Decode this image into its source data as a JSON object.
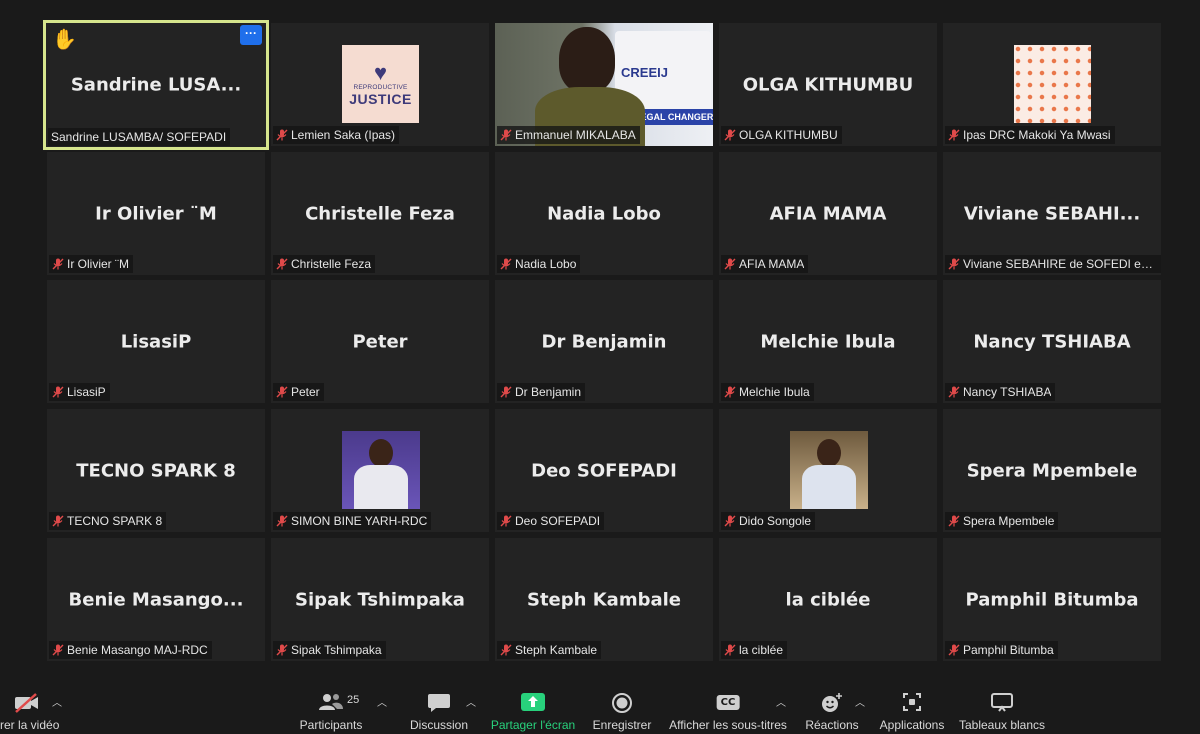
{
  "active_tile": {
    "center_name": "Sandrine LUSA...",
    "tag_name": "Sandrine LUSAMBA/ SOFEPADI",
    "more_label": "···"
  },
  "tiles": [
    {
      "tag": "Lemien Saka (Ipas)",
      "center": "",
      "video": "reproductive-justice-logo"
    },
    {
      "tag": "Emmanuel MIKALABA",
      "center": "",
      "video": "camera-feed"
    },
    {
      "tag": "OLGA KITHUMBU",
      "center": "OLGA KITHUMBU"
    },
    {
      "tag": "Ipas DRC Makoki Ya Mwasi",
      "center": "",
      "video": "pattern-logo"
    },
    {
      "tag": "Ir Olivier ¨M",
      "center": "Ir Olivier ¨M"
    },
    {
      "tag": "Christelle Feza",
      "center": "Christelle Feza"
    },
    {
      "tag": "Nadia Lobo",
      "center": "Nadia Lobo"
    },
    {
      "tag": "AFIA MAMA",
      "center": "AFIA MAMA"
    },
    {
      "tag": "Viviane SEBAHIRE de SOFEDI en R...",
      "center": "Viviane  SEBAHI..."
    },
    {
      "tag": "LisasiP",
      "center": "LisasiP"
    },
    {
      "tag": "Peter",
      "center": "Peter"
    },
    {
      "tag": "Dr Benjamin",
      "center": "Dr Benjamin"
    },
    {
      "tag": "Melchie Ibula",
      "center": "Melchie Ibula"
    },
    {
      "tag": "Nancy TSHIABA",
      "center": "Nancy TSHIABA"
    },
    {
      "tag": "TECNO SPARK 8",
      "center": "TECNO SPARK 8"
    },
    {
      "tag": "SIMON BINE YARH-RDC",
      "center": "",
      "video": "profile-photo"
    },
    {
      "tag": "Deo SOFEPADI",
      "center": "Deo SOFEPADI"
    },
    {
      "tag": "Dido Songole",
      "center": "",
      "video": "profile-photo"
    },
    {
      "tag": "Spera Mpembele",
      "center": "Spera Mpembele"
    },
    {
      "tag": "Benie Masango MAJ-RDC",
      "center": "Benie  Masango..."
    },
    {
      "tag": "Sipak Tshimpaka",
      "center": "Sipak Tshimpaka"
    },
    {
      "tag": "Steph Kambale",
      "center": "Steph Kambale"
    },
    {
      "tag": "la ciblée",
      "center": "la ciblée"
    },
    {
      "tag": "Pamphil Bitumba",
      "center": "Pamphil Bitumba"
    }
  ],
  "logos": {
    "rj_line1": "REPRODUCTIVE",
    "rj_line2": "JUSTICE",
    "creeij_text": "CREEIJ",
    "creeij_sub": "LEGAL CHANGER"
  },
  "toolbar": {
    "video_label": "rer la vidéo",
    "participants_label": "Participants",
    "participants_count": "25",
    "chat_label": "Discussion",
    "share_label": "Partager l'écran",
    "record_label": "Enregistrer",
    "captions_label": "Afficher les sous-titres",
    "captions_icon_text": "CC",
    "reactions_label": "Réactions",
    "apps_label": "Applications",
    "whiteboards_label": "Tableaux blancs"
  },
  "colors": {
    "active_border": "#d6e58d",
    "share_green": "#28d17c",
    "mute_red": "#e04a4a",
    "more_blue": "#1f6feb"
  }
}
